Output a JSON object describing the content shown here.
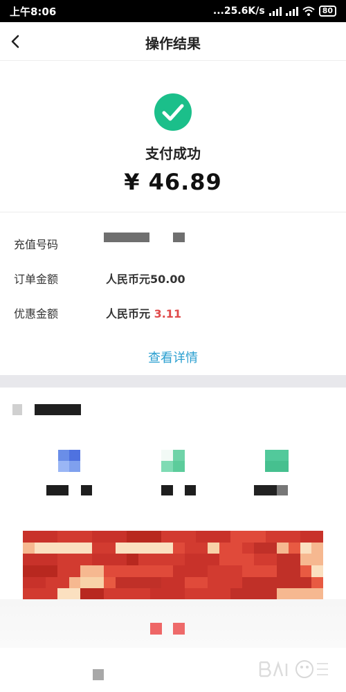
{
  "status_bar": {
    "time": "上午8:06",
    "network_speed": "...25.6K/s",
    "battery": "80"
  },
  "nav": {
    "title": "操作结果"
  },
  "result": {
    "status_text": "支付成功",
    "amount": "¥ 46.89",
    "success_color": "#1bbf8a"
  },
  "details": {
    "rows": [
      {
        "label": "充值号码",
        "value": ""
      },
      {
        "label": "订单金额",
        "value": "人民币元50.00"
      },
      {
        "label": "优惠金额",
        "value_prefix": "人民币元",
        "value_highlight": "3.11"
      }
    ],
    "link_label": "查看详情"
  },
  "colors": {
    "accent_link": "#2a9fd0",
    "highlight_red": "#e04a4a",
    "section_gap": "#e8e8ec"
  }
}
